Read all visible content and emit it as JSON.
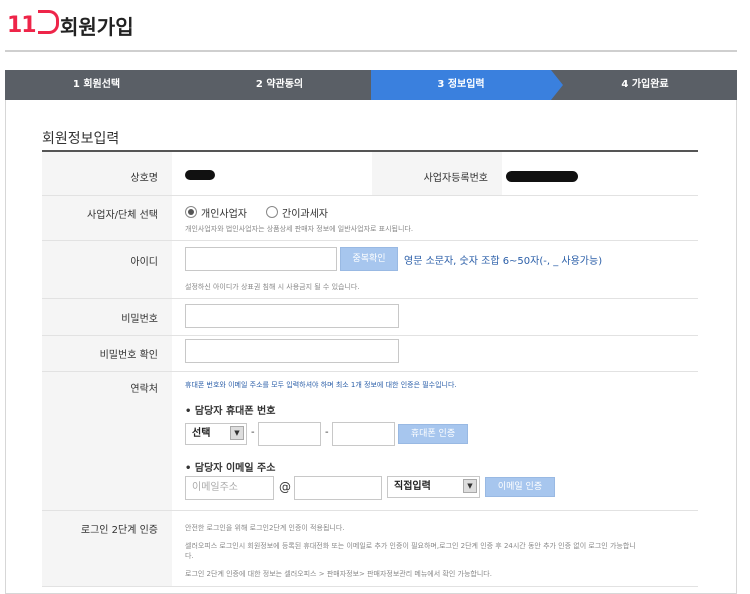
{
  "header": {
    "logo_text": "11",
    "title": "회원가입"
  },
  "steps": [
    {
      "label": "1 회원선택",
      "active": false
    },
    {
      "label": "2 약관동의",
      "active": false
    },
    {
      "label": "3 정보입력",
      "active": true
    },
    {
      "label": "4 가입완료",
      "active": false
    }
  ],
  "section": {
    "title": "회원정보입력"
  },
  "form": {
    "company_name_label": "상호명",
    "biz_number_label": "사업자등록번호",
    "biz_type_label": "사업자/단체 선택",
    "biz_type_options": [
      "개인사업자",
      "간이과세자"
    ],
    "biz_type_selected": "개인사업자",
    "biz_type_help": "개인사업자와 법인사업자는 상품상세 판매자 정보에 일반사업자로 표시됩니다.",
    "id_label": "아이디",
    "id_check_button": "중복확인",
    "id_hint": "영문 소문자, 숫자 조합 6~50자(-, _ 사용가능)",
    "id_help": "설정하신 아이디가 상표권 침해 시 사용금지 될 수 있습니다.",
    "password_label": "비밀번호",
    "password_confirm_label": "비밀번호 확인",
    "contact_label": "연락처",
    "contact_help": "휴대폰 번호와 이메일 주소를 모두 입력하셔야 하며 최소 1개 정보에 대한 인증은 필수입니다.",
    "phone_heading": "• 담당자 휴대폰 번호",
    "phone_select_value": "선택",
    "phone_dash": "-",
    "phone_verify_button": "휴대폰 인증",
    "email_heading": "• 담당자 이메일 주소",
    "email_placeholder": "이메일주소",
    "email_at": "@",
    "email_domain_select": "직접입력",
    "email_verify_button": "이메일 인증",
    "login2fa_label": "로그인 2단계 인증",
    "login2fa_help_1": "안전한 로그인을 위해 로그인2단계 인증이 적용됩니다.",
    "login2fa_help_2": "셀러오피스 로그인시 회원정보에 등록된 휴대전화 또는 이메일로 추가 인증이 필요하며,로그인 2단계 인증 후 24시간 동안 추가 인증 없이 로그인 가능합니",
    "login2fa_help_2b": "다.",
    "login2fa_help_3": "로그인 2단계 인증에 대한 정보는 셀러오피스 > 판매자정보> 판매자정보관리 메뉴에서 확인 가능합니다."
  },
  "colors": {
    "brand": "#ee2549",
    "step_active": "#3a80de",
    "step_bg": "#5a5f66",
    "button": "#a7c6ee"
  }
}
